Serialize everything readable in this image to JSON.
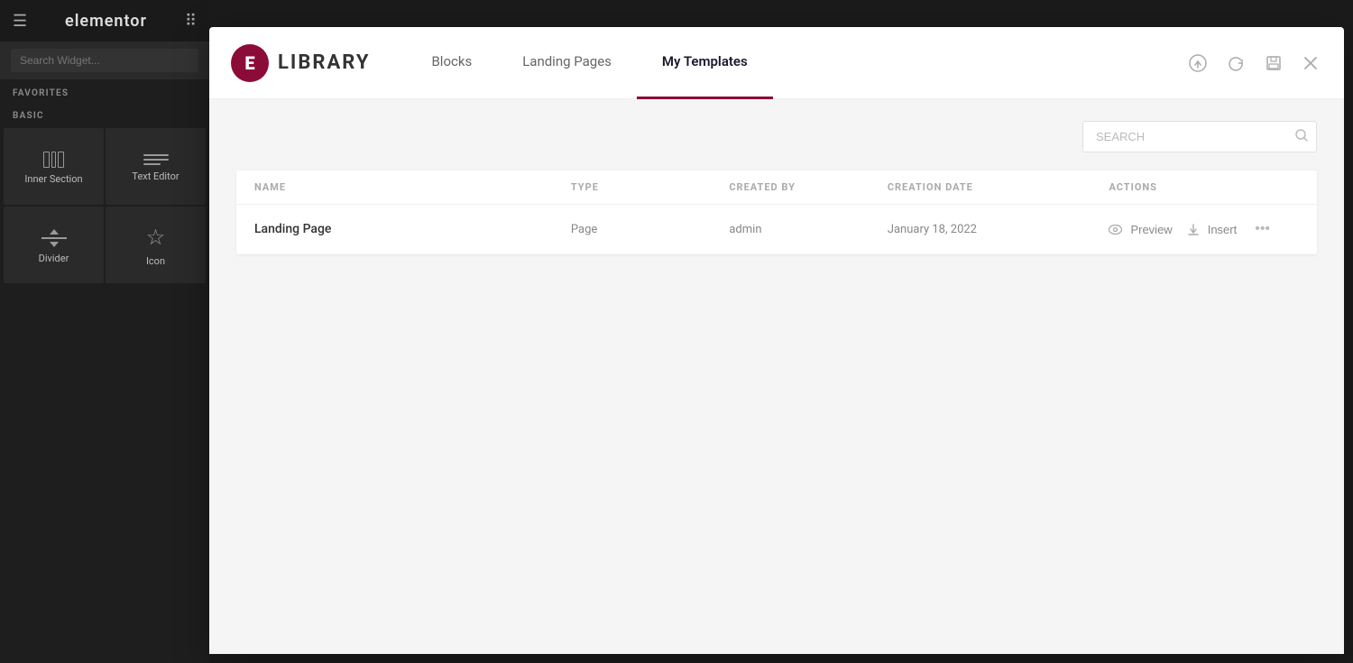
{
  "sidebar": {
    "logo": "elementor",
    "search_placeholder": "Search Widget...",
    "sections": [
      {
        "label": "FAVORITES",
        "widgets": []
      },
      {
        "label": "BASIC",
        "widgets": [
          {
            "id": "inner-section",
            "label": "Inner Section",
            "icon": "inner-section"
          },
          {
            "id": "text-editor",
            "label": "Text Editor",
            "icon": "text-editor"
          },
          {
            "id": "divider",
            "label": "Divider",
            "icon": "divider"
          },
          {
            "id": "icon",
            "label": "Icon",
            "icon": "icon-star"
          }
        ]
      }
    ]
  },
  "library": {
    "logo_letter": "E",
    "title": "LIBRARY",
    "tabs": [
      {
        "id": "blocks",
        "label": "Blocks",
        "active": false
      },
      {
        "id": "landing-pages",
        "label": "Landing Pages",
        "active": false
      },
      {
        "id": "my-templates",
        "label": "My Templates",
        "active": true
      }
    ],
    "header_actions": [
      {
        "id": "upload",
        "icon": "↑",
        "label": "Upload"
      },
      {
        "id": "refresh",
        "icon": "↻",
        "label": "Refresh"
      },
      {
        "id": "save",
        "icon": "⊟",
        "label": "Save"
      },
      {
        "id": "close",
        "icon": "✕",
        "label": "Close"
      }
    ],
    "search": {
      "placeholder": "SEARCH"
    },
    "table": {
      "columns": [
        "NAME",
        "TYPE",
        "CREATED BY",
        "CREATION DATE",
        "ACTIONS"
      ],
      "rows": [
        {
          "name": "Landing Page",
          "type": "Page",
          "created_by": "admin",
          "creation_date": "January 18, 2022",
          "actions": [
            "Preview",
            "Insert"
          ]
        }
      ]
    }
  }
}
